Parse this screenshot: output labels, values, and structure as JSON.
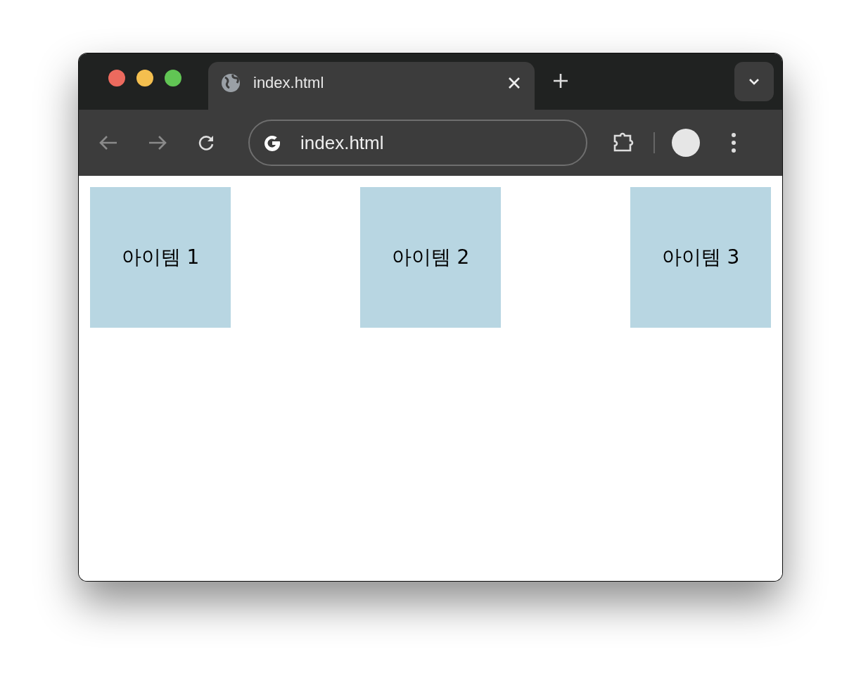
{
  "tabs": [
    {
      "label": "index.html",
      "selected": true
    }
  ],
  "address_bar": {
    "value": "index.html"
  },
  "items": [
    {
      "label": "아이템 1"
    },
    {
      "label": "아이템 2"
    },
    {
      "label": "아이템 3"
    }
  ]
}
